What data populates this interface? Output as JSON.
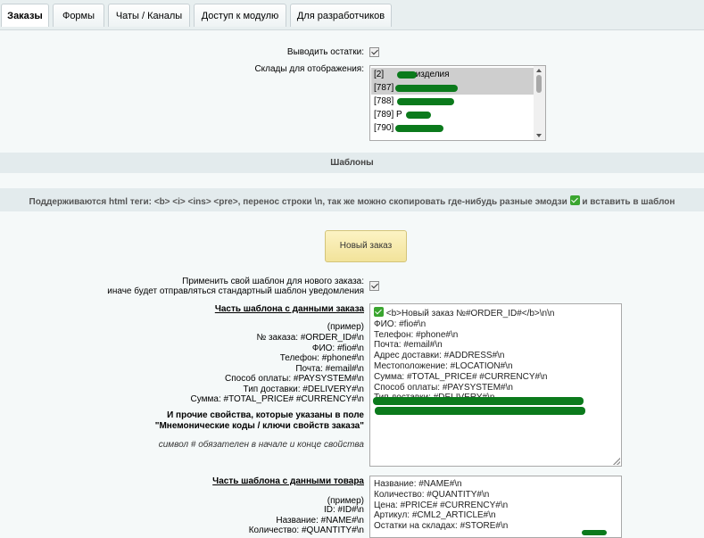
{
  "tabs": [
    {
      "label": "Заказы",
      "active": true
    },
    {
      "label": "Формы"
    },
    {
      "label": "Чаты / Каналы"
    },
    {
      "label": "Доступ к модулю"
    },
    {
      "label": "Для разработчиков"
    }
  ],
  "settings": {
    "show_remains_label": "Выводить остатки:",
    "show_remains_checked": true,
    "warehouses_label": "Склады для отображения:",
    "warehouses": [
      {
        "label": "[2]",
        "suffix": "изделия",
        "selected": true
      },
      {
        "label": "[787]",
        "suffix": "",
        "selected": true
      },
      {
        "label": "[788]",
        "suffix": "",
        "selected": false
      },
      {
        "label": "[789] Р",
        "suffix": "",
        "selected": false
      },
      {
        "label": "[790]",
        "suffix": "",
        "selected": false
      }
    ]
  },
  "templates_header": "Шаблоны",
  "html_note": {
    "before": "Поддерживаются html теги: <b> <i> <ins> <pre>, перенос строки \\n, так же можно скопировать где-нибудь разные эмодзи",
    "after": "и вставить в шаблон"
  },
  "new_order_button": "Новый заказ",
  "apply_template": {
    "line1": "Применить свой шаблон для нового заказа:",
    "line2": "иначе будет отправляться стандартный шаблон уведомления",
    "checked": true
  },
  "order_part": {
    "title": "Часть шаблона с данными заказа",
    "example_title": "(пример)",
    "examples": [
      "№ заказа: #ORDER_ID#\\n",
      "ФИО: #fio#\\n",
      "Телефон: #phone#\\n",
      "Почта: #email#\\n",
      "Способ оплаты: #PAYSYSTEM#\\n",
      "Тип доставки: #DELIVERY#\\n",
      "Сумма: #TOTAL_PRICE# #CURRENCY#\\n"
    ],
    "other_props_line1": "И прочие свойства, которые указаны в поле",
    "other_props_line2": "\"Мнемонические коды / ключи свойств заказа\"",
    "symbol_note": "символ # обязателен в начале и конце свойства",
    "textarea_first_line": "<b>Новый заказ  №#ORDER_ID#</b>\\n\\n",
    "textarea_lines": [
      "ФИО: #fio#\\n",
      "Телефон: #phone#\\n",
      "Почта: #email#\\n",
      "Адрес доставки: #ADDRESS#\\n",
      "Местоположение: #LOCATION#\\n",
      "Сумма: #TOTAL_PRICE# #CURRENCY#\\n",
      "Способ оплаты: #PAYSYSTEM#\\n",
      "Тип доставки: #DELIVERY#\\n"
    ]
  },
  "product_part": {
    "title": "Часть шаблона с данными товара",
    "example_title": "(пример)",
    "examples": [
      "ID: #ID#\\n",
      "Название: #NAME#\\n",
      "Количество: #QUANTITY#\\n"
    ],
    "textarea_lines": [
      "Название: #NAME#\\n",
      "Количество: #QUANTITY#\\n",
      "Цена: #PRICE# #CURRENCY#\\n",
      "Артикул: #CML2_ARTICLE#\\n",
      "Остатки на складах: #STORE#\\n"
    ]
  },
  "colors": {
    "accent_green": "#3aa52f",
    "redaction": "#0b7a1c",
    "band": "#e3ebed",
    "button": "#f2e39a"
  }
}
